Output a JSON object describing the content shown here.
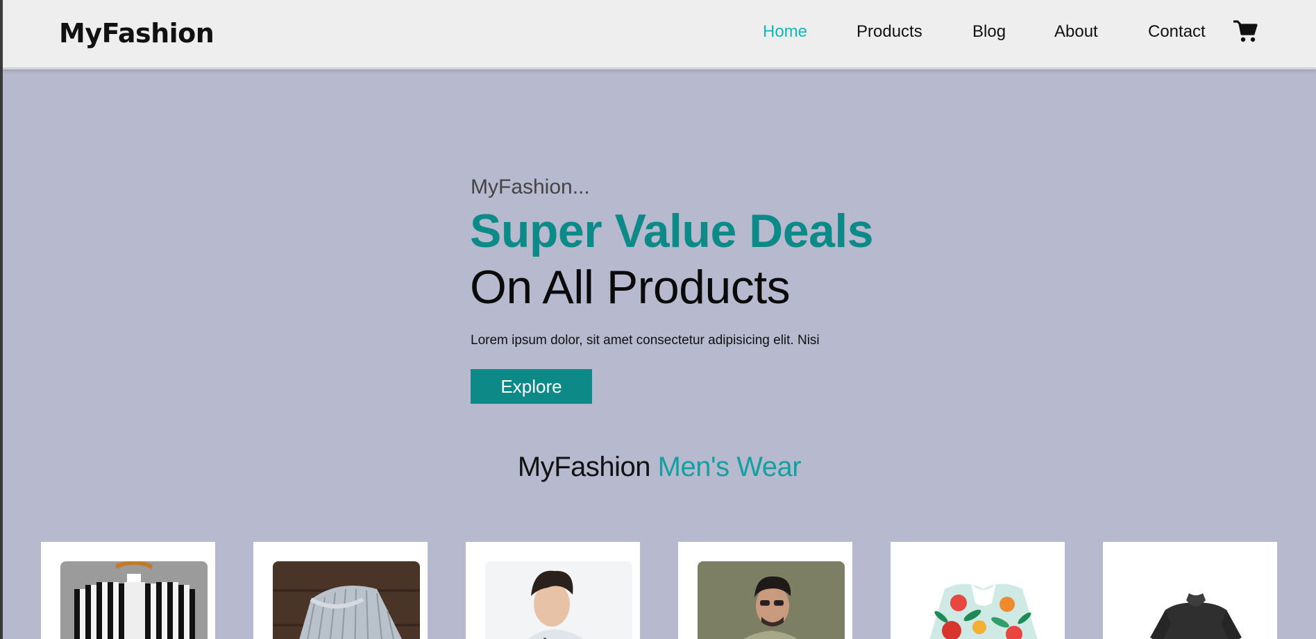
{
  "header": {
    "logo": "MyFashion",
    "nav": [
      {
        "label": "Home",
        "active": true
      },
      {
        "label": "Products"
      },
      {
        "label": "Blog"
      },
      {
        "label": "About"
      },
      {
        "label": "Contact"
      }
    ],
    "cart_icon": "shopping-cart-icon"
  },
  "hero": {
    "kicker": "MyFashion...",
    "title_line1": "Super Value Deals",
    "title_line2": "On All Products",
    "text": "Lorem ipsum dolor, sit amet consectetur adipisicing elit. Nisi",
    "button": "Explore"
  },
  "section": {
    "title_main": "MyFashion",
    "title_accent": "Men's Wear"
  },
  "products": [
    {
      "image": "striped-black-white-shirt"
    },
    {
      "image": "grey-striped-folded-shirt"
    },
    {
      "image": "man-in-printed-shirt"
    },
    {
      "image": "man-in-olive-shirt-sunglasses"
    },
    {
      "image": "floral-hawaiian-shirt"
    },
    {
      "image": "black-shirt"
    }
  ],
  "colors": {
    "accent": "#0c8a88",
    "nav_active": "#14b5b5",
    "background": "#b7b9cf",
    "header_bg": "#eeeeee"
  }
}
